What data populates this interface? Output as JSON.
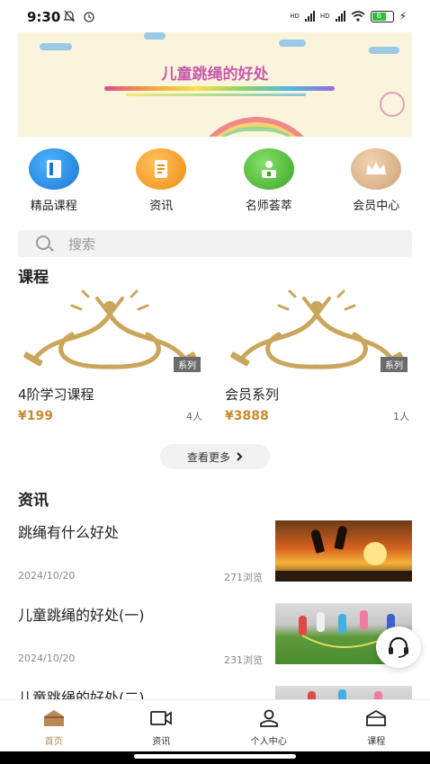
{
  "status_bar": {
    "time": "9:30",
    "battery_label": "6",
    "network_hd1": "HD",
    "network_hd2": "HD"
  },
  "banner": {
    "title": "儿童跳绳的好处"
  },
  "quick_nav": [
    {
      "label": "精品课程",
      "icon": "book-icon",
      "color": "#1e88e5"
    },
    {
      "label": "资讯",
      "icon": "document-icon",
      "color": "#f39c1f"
    },
    {
      "label": "名师荟萃",
      "icon": "teacher-icon",
      "color": "#43b02a"
    },
    {
      "label": "会员中心",
      "icon": "crown-icon",
      "color": "#d2a87c"
    }
  ],
  "search": {
    "placeholder": "搜索"
  },
  "courses_section": {
    "title": "课程",
    "items": [
      {
        "name": "4阶学习课程",
        "price": "¥199",
        "count": "4人",
        "tag": "系列"
      },
      {
        "name": "会员系列",
        "price": "¥3888",
        "count": "1人",
        "tag": "系列"
      }
    ],
    "more_label": "查看更多"
  },
  "news_section": {
    "title": "资讯",
    "items": [
      {
        "title": "跳绳有什么好处",
        "date": "2024/10/20",
        "views": "271浏览"
      },
      {
        "title": "儿童跳绳的好处(一)",
        "date": "2024/10/20",
        "views": "231浏览"
      },
      {
        "title": "儿童跳绳的好处(二)",
        "date": "",
        "views": ""
      }
    ]
  },
  "tabbar": {
    "items": [
      {
        "label": "首页",
        "icon": "home-icon",
        "active": true
      },
      {
        "label": "资讯",
        "icon": "video-icon",
        "active": false
      },
      {
        "label": "个人中心",
        "icon": "user-icon",
        "active": false
      },
      {
        "label": "课程",
        "icon": "course-icon",
        "active": false
      }
    ]
  },
  "colors": {
    "accent": "#b98a58",
    "price": "#c88a30"
  }
}
